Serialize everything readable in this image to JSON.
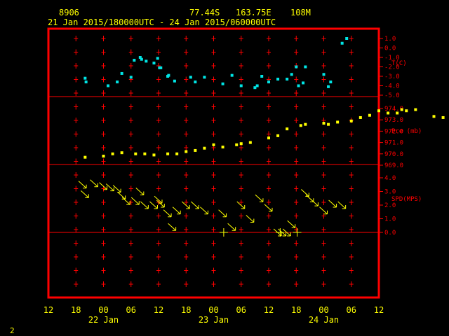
{
  "header": {
    "station_id": "8906",
    "latitude": "77.44S",
    "longitude": "163.75E",
    "elevation": "108M",
    "time_range": "21 Jan 2015/180000UTC - 24 Jan 2015/060000UTC"
  },
  "page_number": "2",
  "colors": {
    "frame": "#ff0000",
    "text": "#ffff00",
    "temp": "#00e5e5",
    "pres": "#ffff00",
    "wind": "#ffff00"
  },
  "chart_data": [
    {
      "type": "scatter",
      "panel": "temperature",
      "ylabel": "T(C)",
      "ylim": [
        -5.0,
        1.0
      ],
      "ticks": [
        "1.0",
        "0.0",
        "-1.0",
        "-2.0",
        "-3.0",
        "-4.0",
        "-5.0"
      ],
      "x_unit": "hours since 21 Jan 00 UTC",
      "x": [
        44.0,
        44.2,
        49.0,
        51.0,
        52.0,
        54.0,
        54.7,
        56.0,
        56.3,
        57.3,
        59.0,
        59.8,
        60.2,
        60.5,
        62.0,
        62.2,
        63.5,
        67.0,
        68.0,
        70.0,
        74.0,
        76.0,
        78.0,
        81.0,
        81.5,
        82.5,
        84.0,
        86.0,
        88.0,
        89.0,
        90.0,
        90.5,
        91.5,
        92.0,
        96.0,
        97.0,
        97.5,
        100.0,
        101.0
      ],
      "y": [
        -3.2,
        -3.6,
        -4.0,
        -3.6,
        -2.7,
        -3.1,
        -1.3,
        -1.0,
        -1.2,
        -1.4,
        -1.6,
        -1.1,
        -2.1,
        -2.1,
        -3.0,
        -2.9,
        -3.5,
        -3.1,
        -3.6,
        -3.1,
        -3.8,
        -2.9,
        -4.0,
        -4.2,
        -4.0,
        -3.0,
        -3.6,
        -3.3,
        -3.3,
        -2.8,
        -2.0,
        -4.0,
        -3.7,
        -2.0,
        -2.8,
        -4.1,
        -3.6,
        0.5,
        1.0
      ],
      "notes": "cyan point markers"
    },
    {
      "type": "scatter",
      "panel": "pressure",
      "ylabel": "Pre (mb)",
      "ylim": [
        969.0,
        974.0
      ],
      "ticks": [
        "974.0",
        "973.0",
        "972.0",
        "971.0",
        "970.0",
        "969.0"
      ],
      "x": [
        44,
        48,
        50,
        52,
        55,
        57,
        59,
        62,
        64,
        66,
        68,
        70,
        72,
        74,
        77,
        78,
        80,
        84,
        86,
        88,
        91,
        92,
        96,
        97,
        99,
        102,
        104,
        106,
        108,
        110,
        112,
        113,
        114,
        116,
        120,
        122,
        124,
        126,
        128
      ],
      "y": [
        969.7,
        969.8,
        970.0,
        970.1,
        970.0,
        970.0,
        969.9,
        970.0,
        970.0,
        970.2,
        970.3,
        970.5,
        970.8,
        970.6,
        970.8,
        970.9,
        971.0,
        971.4,
        971.6,
        972.2,
        972.5,
        972.6,
        972.7,
        972.6,
        972.8,
        972.9,
        973.2,
        973.4,
        973.8,
        973.6,
        973.6,
        973.9,
        973.8,
        973.9,
        973.3,
        973.2,
        973.2,
        973.0,
        972.8
      ]
    },
    {
      "type": "scatter",
      "panel": "wind",
      "ylabel": "SPD(MPS)",
      "ylim": [
        0.0,
        4.0
      ],
      "ticks": [
        "4.0",
        "3.0",
        "2.0",
        "1.0",
        "0.0"
      ],
      "x": [
        43.5,
        44,
        46,
        48,
        49.5,
        51,
        52,
        53,
        55,
        56,
        57,
        59,
        60,
        60.5,
        62,
        63,
        64,
        66,
        68,
        70,
        74,
        76,
        78,
        80,
        82,
        84,
        86,
        87,
        88,
        89,
        92,
        93,
        94,
        96,
        98,
        100
      ],
      "speed": [
        3.5,
        2.8,
        3.6,
        3.4,
        3.3,
        3.2,
        2.7,
        2.3,
        2.3,
        3.0,
        2.0,
        2.0,
        2.4,
        2.1,
        1.4,
        0.4,
        1.6,
        2.0,
        2.0,
        1.6,
        1.4,
        0.4,
        2.0,
        1.0,
        2.5,
        1.8,
        0.0,
        0.0,
        0.0,
        0.6,
        2.9,
        2.5,
        2.2,
        1.6,
        2.1,
        2.0
      ],
      "calm_marks_x": [
        74.2,
        86.5,
        90.2
      ]
    }
  ],
  "x_axis": {
    "tick_labels": [
      "12",
      "18",
      "00",
      "06",
      "12",
      "18",
      "00",
      "06",
      "12",
      "18",
      "00",
      "06",
      "12"
    ],
    "date_labels": [
      "22 Jan",
      "23 Jan",
      "24 Jan"
    ]
  },
  "panels": [
    "temperature",
    "pressure",
    "wind"
  ]
}
